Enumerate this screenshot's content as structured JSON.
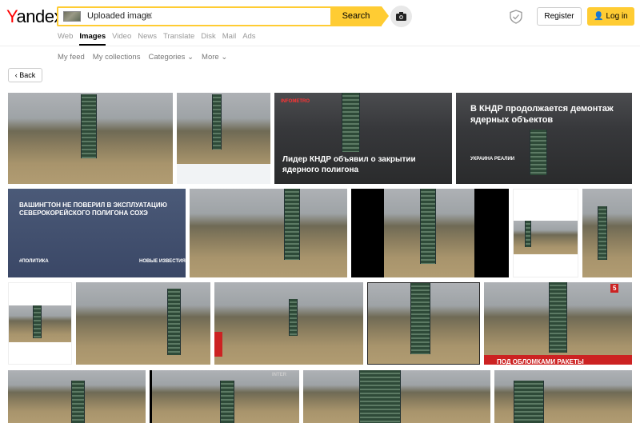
{
  "logo": {
    "ya": "Y",
    "rest": "andex"
  },
  "search": {
    "uploaded_label": "Uploaded image",
    "button": "Search",
    "placeholder": ""
  },
  "header": {
    "register": "Register",
    "login": "Log in"
  },
  "tabs": [
    {
      "label": "Web"
    },
    {
      "label": "Images"
    },
    {
      "label": "Video"
    },
    {
      "label": "News"
    },
    {
      "label": "Translate"
    },
    {
      "label": "Disk"
    },
    {
      "label": "Mail"
    },
    {
      "label": "Ads"
    }
  ],
  "subnav": {
    "feed": "My feed",
    "collections": "My collections",
    "categories": "Categories",
    "more": "More"
  },
  "back": "Back",
  "captions": {
    "c3": "Лидер КНДР объявил о закрытии ядерного полигона",
    "c3_logo": "INFOMETRO",
    "c4": "В КНДР продолжается демонтаж ядерных объектов",
    "c4_src": "УКРАИНА РЕАЛИИ",
    "c5": "ВАШИНГТОН НЕ ПОВЕРИЛ В ЭКСПЛУАТАЦИЮ СЕВЕРОКОРЕЙСКОГО ПОЛИГОНА СОХЭ",
    "c5_tag": "#ПОЛИТИКА",
    "c5_src": "НОВЫЕ ИЗВЕСТИЯ",
    "c13": "ПОД ОБЛОМКАМИ РАКЕТЫ",
    "c13_logo": "5",
    "c15": "INTER"
  },
  "colors": {
    "accent": "#fc3",
    "brand_red": "#f00"
  }
}
